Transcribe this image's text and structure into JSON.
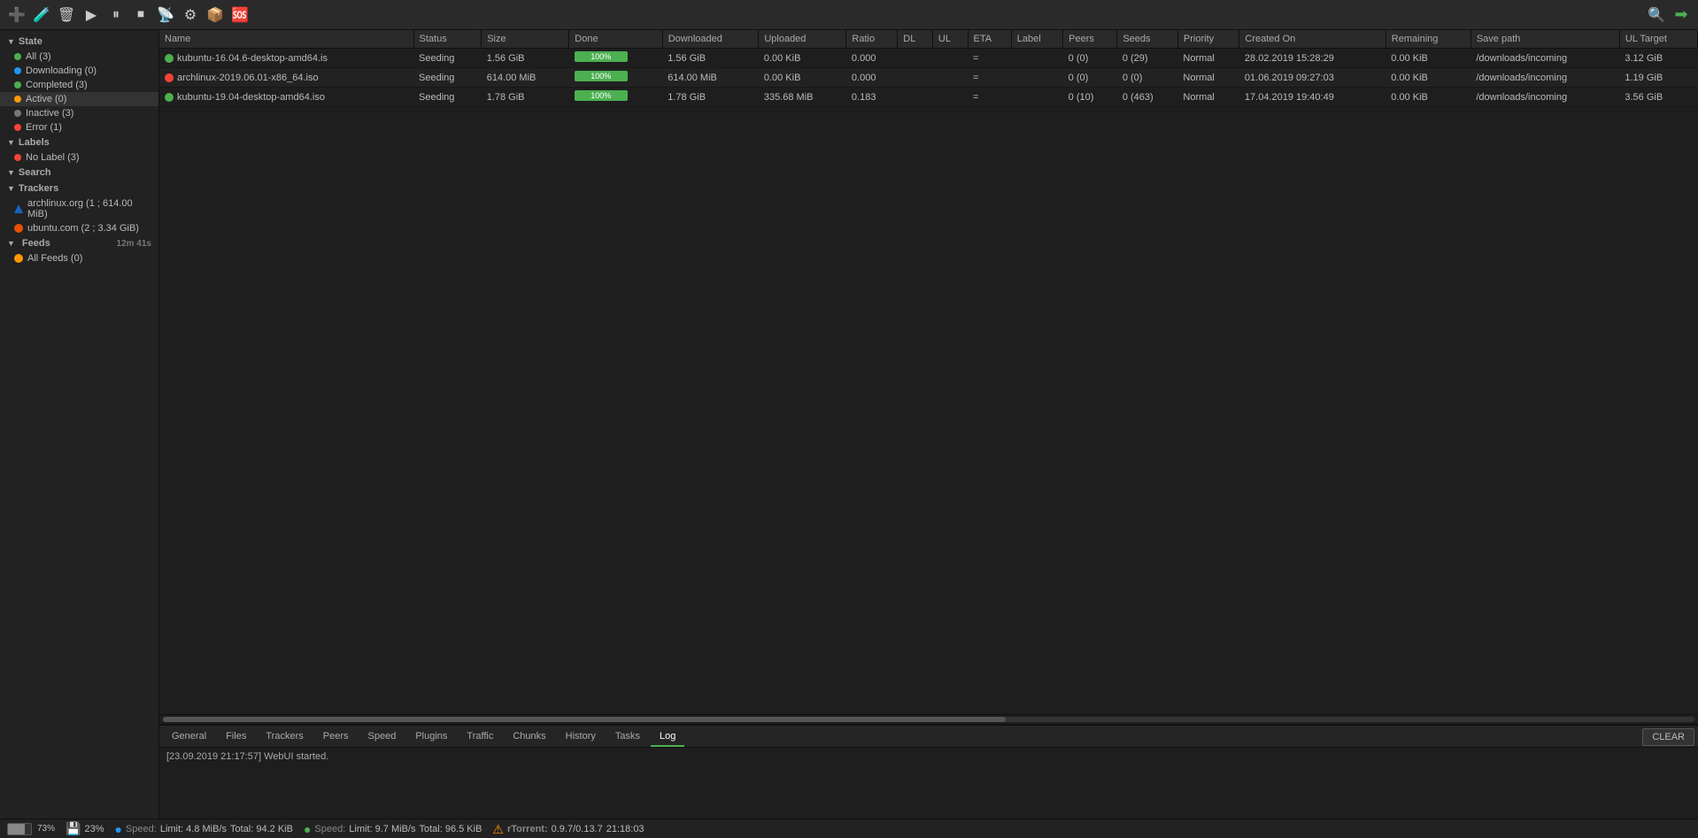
{
  "toolbar": {
    "icons": [
      {
        "name": "add-icon",
        "symbol": "➕",
        "title": "Add Torrent"
      },
      {
        "name": "flask-icon",
        "symbol": "🧪",
        "title": "Test"
      },
      {
        "name": "delete-icon",
        "symbol": "🗑",
        "title": "Remove"
      },
      {
        "name": "start-icon",
        "symbol": "▶",
        "title": "Start"
      },
      {
        "name": "pause-icon",
        "symbol": "⏸",
        "title": "Pause"
      },
      {
        "name": "stop-icon",
        "symbol": "⏹",
        "title": "Stop"
      },
      {
        "name": "rss-icon",
        "symbol": "📡",
        "title": "RSS"
      },
      {
        "name": "settings-icon",
        "symbol": "⚙",
        "title": "Settings"
      },
      {
        "name": "package-icon",
        "symbol": "📦",
        "title": "Package"
      },
      {
        "name": "help-icon",
        "symbol": "🆘",
        "title": "Help"
      }
    ],
    "search_placeholder": "Search",
    "arrow_right_symbol": "➡"
  },
  "sidebar": {
    "state_label": "State",
    "state_items": [
      {
        "label": "All (3)",
        "dot": "green",
        "name": "all"
      },
      {
        "label": "Downloading (0)",
        "dot": "blue",
        "name": "downloading"
      },
      {
        "label": "Completed (3)",
        "dot": "green",
        "name": "completed"
      },
      {
        "label": "Active (0)",
        "dot": "orange",
        "name": "active"
      },
      {
        "label": "Inactive (3)",
        "dot": "gray",
        "name": "inactive"
      },
      {
        "label": "Error (1)",
        "dot": "red",
        "name": "error"
      }
    ],
    "labels_label": "Labels",
    "label_items": [
      {
        "label": "No Label (3)",
        "dot": "red",
        "name": "no-label"
      }
    ],
    "search_label": "Search",
    "trackers_label": "Trackers",
    "tracker_items": [
      {
        "label": "archlinux.org (1 ; 614.00 MiB)",
        "type": "arch"
      },
      {
        "label": "ubuntu.com (2 ; 3.34 GiB)",
        "type": "ubuntu"
      }
    ],
    "feeds_label": "Feeds",
    "feeds_time": "12m 41s",
    "feed_items": [
      {
        "label": "All Feeds (0)",
        "type": "feeds"
      }
    ]
  },
  "table": {
    "columns": [
      {
        "key": "name",
        "label": "Name"
      },
      {
        "key": "status",
        "label": "Status"
      },
      {
        "key": "size",
        "label": "Size"
      },
      {
        "key": "done",
        "label": "Done"
      },
      {
        "key": "downloaded",
        "label": "Downloaded"
      },
      {
        "key": "uploaded",
        "label": "Uploaded"
      },
      {
        "key": "ratio",
        "label": "Ratio"
      },
      {
        "key": "dl",
        "label": "DL"
      },
      {
        "key": "ul",
        "label": "UL"
      },
      {
        "key": "eta",
        "label": "ETA"
      },
      {
        "key": "label",
        "label": "Label"
      },
      {
        "key": "peers",
        "label": "Peers"
      },
      {
        "key": "seeds",
        "label": "Seeds"
      },
      {
        "key": "priority",
        "label": "Priority"
      },
      {
        "key": "created_on",
        "label": "Created On"
      },
      {
        "key": "remaining",
        "label": "Remaining"
      },
      {
        "key": "save_path",
        "label": "Save path"
      },
      {
        "key": "ul_target",
        "label": "UL Target"
      }
    ],
    "rows": [
      {
        "name": "kubuntu-16.04.6-desktop-amd64.is",
        "status": "Seeding",
        "status_dot": "green",
        "size": "1.56 GiB",
        "done_pct": 100,
        "done_label": "100%",
        "downloaded": "1.56 GiB",
        "uploaded": "0.00 KiB",
        "ratio": "0.000",
        "dl": "",
        "ul": "",
        "eta": "=",
        "label": "",
        "peers": "0 (0)",
        "seeds": "0 (29)",
        "priority": "Normal",
        "created_on": "28.02.2019 15:28:29",
        "remaining": "0.00 KiB",
        "save_path": "/downloads/incoming",
        "ul_target": "3.12 GiB"
      },
      {
        "name": "archlinux-2019.06.01-x86_64.iso",
        "status": "Seeding",
        "status_dot": "red",
        "size": "614.00 MiB",
        "done_pct": 100,
        "done_label": "100%",
        "downloaded": "614.00 MiB",
        "uploaded": "0.00 KiB",
        "ratio": "0.000",
        "dl": "",
        "ul": "",
        "eta": "=",
        "label": "",
        "peers": "0 (0)",
        "seeds": "0 (0)",
        "priority": "Normal",
        "created_on": "01.06.2019 09:27:03",
        "remaining": "0.00 KiB",
        "save_path": "/downloads/incoming",
        "ul_target": "1.19 GiB"
      },
      {
        "name": "kubuntu-19.04-desktop-amd64.iso",
        "status": "Seeding",
        "status_dot": "green",
        "size": "1.78 GiB",
        "done_pct": 100,
        "done_label": "100%",
        "downloaded": "1.78 GiB",
        "uploaded": "335.68 MiB",
        "ratio": "0.183",
        "dl": "",
        "ul": "",
        "eta": "=",
        "label": "",
        "peers": "0 (10)",
        "seeds": "0 (463)",
        "priority": "Normal",
        "created_on": "17.04.2019 19:40:49",
        "remaining": "0.00 KiB",
        "save_path": "/downloads/incoming",
        "ul_target": "3.56 GiB"
      }
    ]
  },
  "bottom_tabs": {
    "tabs": [
      {
        "label": "General",
        "name": "general-tab"
      },
      {
        "label": "Files",
        "name": "files-tab"
      },
      {
        "label": "Trackers",
        "name": "trackers-tab"
      },
      {
        "label": "Peers",
        "name": "peers-tab"
      },
      {
        "label": "Speed",
        "name": "speed-tab"
      },
      {
        "label": "Plugins",
        "name": "plugins-tab"
      },
      {
        "label": "Traffic",
        "name": "traffic-tab"
      },
      {
        "label": "Chunks",
        "name": "chunks-tab"
      },
      {
        "label": "History",
        "name": "history-tab"
      },
      {
        "label": "Tasks",
        "name": "tasks-tab"
      },
      {
        "label": "Log",
        "name": "log-tab",
        "active": true
      }
    ],
    "clear_label": "CLEAR",
    "log_entry": "[23.09.2019 21:17:57] WebUI started."
  },
  "statusbar": {
    "hdd_percent": 73,
    "hdd_label": "73%",
    "disk_icon_label": "23%",
    "dl_label": "Speed:",
    "dl_limit": "Limit:  4.8 MiB/s",
    "dl_total": "Total:  94.2 KiB",
    "ul_label": "Speed:",
    "ul_limit": "Limit:  9.7 MiB/s",
    "ul_total": "Total:  96.5 KiB",
    "rt_label": "rTorrent:",
    "rt_version": "0.9.7/0.13.7",
    "time": "21:18:03"
  }
}
